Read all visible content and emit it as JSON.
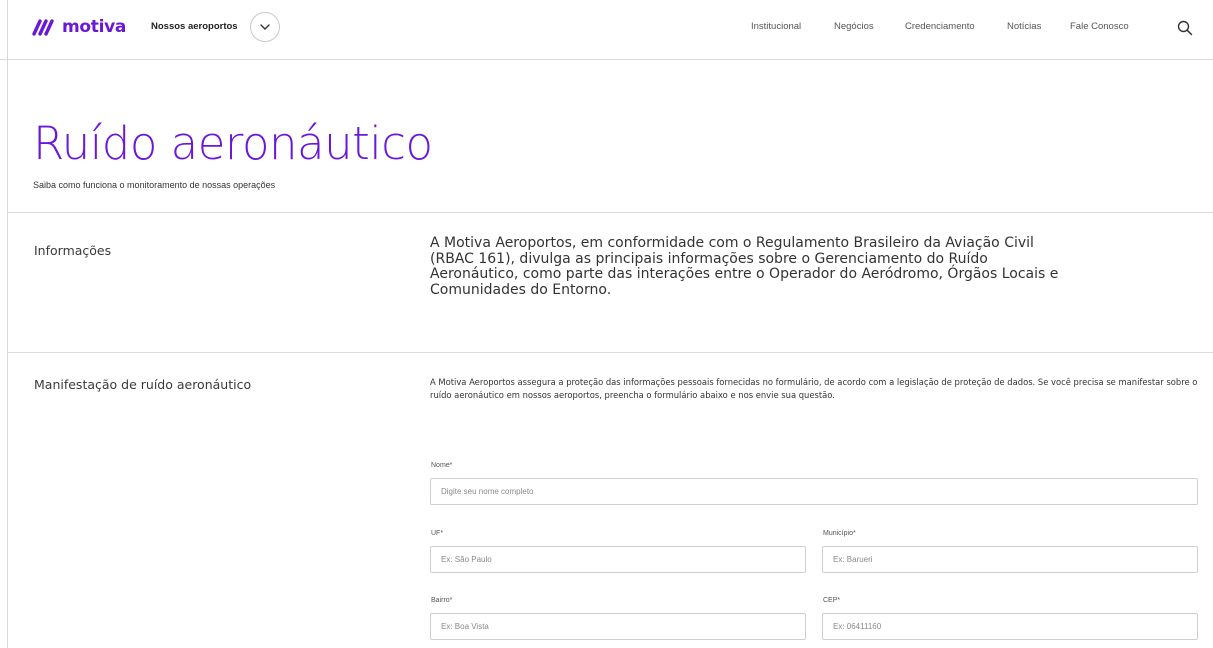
{
  "header": {
    "brand": "motiva",
    "airports_label": "Nossos aeroportos",
    "nav": [
      "Institucional",
      "Negócios",
      "Credenciamento",
      "Notícias",
      "Fale Conosco"
    ],
    "brand_color": "#6a18d8"
  },
  "hero": {
    "title": "Ruído aeronáutico",
    "subtitle": "Saiba como funciona o monitoramento de nossas operações"
  },
  "info": {
    "label": "Informações",
    "text": "A Motiva Aeroportos, em conformidade com o Regulamento Brasileiro da Aviação Civil (RBAC 161), divulga as principais informações sobre o Gerenciamento do Ruído Aeronáutico, como parte das interações entre o Operador do Aeródromo, Órgãos Locais e Comunidades do Entorno."
  },
  "manifestation": {
    "label": "Manifestação de ruído aeronáutico",
    "text": "A Motiva Aeroportos assegura a proteção das informações pessoais fornecidas no formulário, de acordo com a legislação de proteção de dados.  Se você precisa se manifestar sobre o ruído aeronáutico em nossos aeroportos, preencha o formulário abaixo e nos envie sua questão."
  },
  "form": {
    "name": {
      "label": "Nome*",
      "placeholder": "Digite seu nome completo"
    },
    "uf": {
      "label": "UF*",
      "placeholder": "Ex: São Paulo"
    },
    "municipio": {
      "label": "Município*",
      "placeholder": "Ex: Barueri"
    },
    "bairro": {
      "label": "Bairro*",
      "placeholder": "Ex: Boa Vista"
    },
    "cep": {
      "label": "CEP*",
      "placeholder": "Ex: 06411160"
    }
  }
}
